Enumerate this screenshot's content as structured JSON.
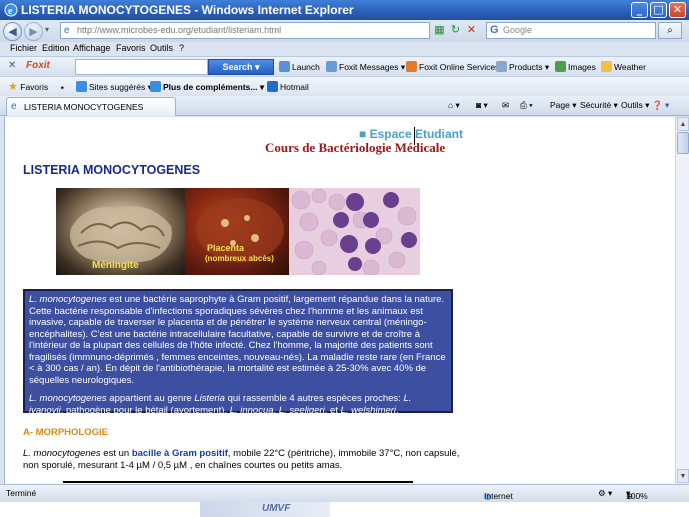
{
  "window": {
    "title": "LISTERIA MONOCYTOGENES - Windows Internet Explorer",
    "minimize": "_",
    "maximize": "□",
    "close": "✕"
  },
  "address": {
    "url": "http://www.microbes-edu.org/etudiant/listeriam.html",
    "search_placeholder": "Google",
    "back_icon": "back-arrow-icon",
    "forward_icon": "forward-arrow-icon"
  },
  "menu": [
    "Fichier",
    "Edition",
    "Affichage",
    "Favoris",
    "Outils",
    "?"
  ],
  "foxit_toolbar": {
    "logo": "Foxit",
    "search_label": "Search",
    "items": [
      "Launch",
      "Foxit Messages",
      "Foxit Online Services",
      "Products",
      "Images",
      "Weather"
    ]
  },
  "favorites_bar": {
    "favoris": "Favoris",
    "sites": "Sites suggérés",
    "plus": "Plus de compléments...",
    "hotmail": "Hotmail"
  },
  "tab": {
    "label": "LISTERIA MONOCYTOGENES"
  },
  "commands": {
    "page": "Page",
    "securite": "Sécurité",
    "outils": "Outils"
  },
  "page": {
    "espace": "■ Espace Etudiant",
    "cours": "Cours de Bactériologie Médicale",
    "heading": "LISTERIA MONOCYTOGENES",
    "photos": {
      "meningite": "Méningite",
      "placenta": "Placenta",
      "placenta_sub": "(nombreux abcès)"
    },
    "intro_p1_species": "L. monocytogenes",
    "intro_p1": " est une bactérie saprophyte à Gram positif, largement répandue dans la nature. Cette bactérie responsable d'infections sporadiques sévères chez l'homme et les animaux est invasive, capable de traverser le placenta et de pénétrer le système nerveux central (méningo-encéphalites). C'est une bactérie intracellulaire facultative, capable de survivre et de croître à l'intérieur de la plupart des cellules de l'hôte infecté. Chez l'homme, la majorité des patients sont fragilisés (immnuno-déprimés , femmes enceintes, nouveau-nés). La maladie reste rare (en France < à 300 cas / an). En dépit de l'antibiothérapie, la mortalité est estimée à 25-30% avec 40% de séquelles neurologiques.",
    "intro_p2_a": "L. monocytogenes",
    "intro_p2_b": " appartient au genre ",
    "intro_p2_c": "Listeria",
    "intro_p2_d": " qui rassemble 4 autres espèces proches: ",
    "intro_p2_e": "L. ivanovii",
    "intro_p2_f": ", pathogène pour le bétail (avortement), ",
    "intro_p2_g": "L. innocua",
    "intro_p2_h": ",  ",
    "intro_p2_i": "L. seeligeri",
    "intro_p2_j": ", et ",
    "intro_p2_k": "L. welshimeri",
    "intro_p2_l": ".",
    "section_a": "A- MORPHOLOGIE",
    "morph_species": "L. monocytogenes",
    "morph_a": " est un ",
    "morph_bold": "bacille à Gram positif",
    "morph_b": ", mobile 22°C (péritriche), immobile 37°C, non capsulé, non sporulé, mesurant 1-4 µM / 0,5 µM , en chaînes courtes ou petits amas."
  },
  "status": {
    "left": "Terminé",
    "zone": "Internet",
    "zoom": "100%"
  },
  "bottom": {
    "brand": "UMVF"
  }
}
